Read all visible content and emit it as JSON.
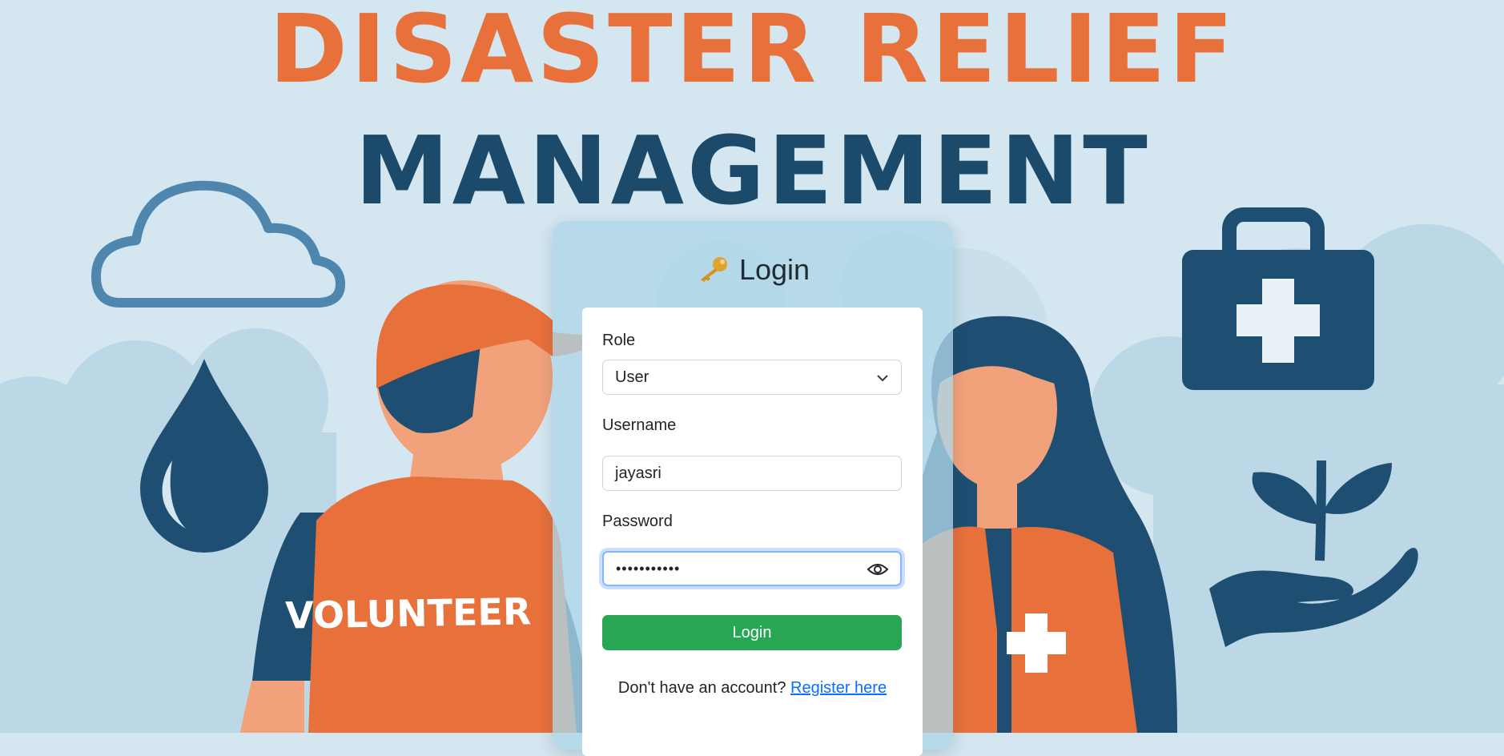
{
  "hero": {
    "title_line1": "DISASTER RELIEF",
    "title_line2": "MANAGEMENT",
    "vest_text": "VOLUNTEER"
  },
  "login": {
    "title": "Login",
    "title_icon": "key-icon",
    "role_label": "Role",
    "role_value": "User",
    "username_label": "Username",
    "username_value": "jayasri",
    "password_label": "Password",
    "password_value": "•••••••••••",
    "submit_label": "Login",
    "register_prompt": "Don't have an account?",
    "register_link": "Register here"
  },
  "colors": {
    "title_orange": "#e8703a",
    "title_navy": "#1b4a6b",
    "login_green": "#28a653",
    "link_blue": "#0d6efd",
    "background": "#d4e6ef"
  }
}
